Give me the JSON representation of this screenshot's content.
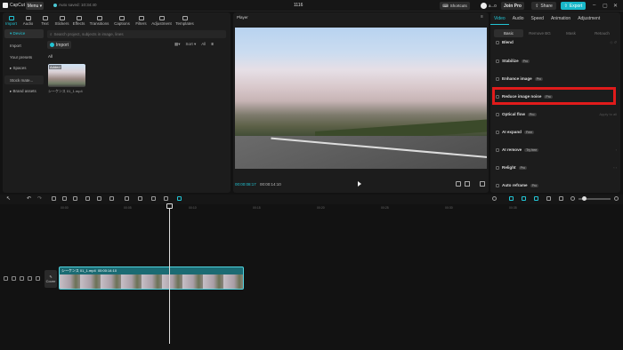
{
  "titlebar": {
    "app_name": "CapCut",
    "menu_label": "Menu",
    "autosave_text": "Auto saved: 10:34:40",
    "project_title": "1116",
    "shortcuts_label": "Shortcuts",
    "user_name": "a...0",
    "join_pro_label": "Join Pro",
    "share_label": "Share",
    "export_label": "Export"
  },
  "media_tabs": [
    {
      "label": "Import",
      "icon": "import-icon"
    },
    {
      "label": "Audio",
      "icon": "audio-icon"
    },
    {
      "label": "Text",
      "icon": "text-icon"
    },
    {
      "label": "Stickers",
      "icon": "stickers-icon"
    },
    {
      "label": "Effects",
      "icon": "effects-icon"
    },
    {
      "label": "Transitions",
      "icon": "transitions-icon"
    },
    {
      "label": "Captions",
      "icon": "captions-icon"
    },
    {
      "label": "Filters",
      "icon": "filters-icon"
    },
    {
      "label": "Adjustment",
      "icon": "adjustment-icon"
    },
    {
      "label": "Templates",
      "icon": "templates-icon"
    }
  ],
  "side_nav": [
    "▾ Device",
    "Import",
    "Your presets",
    "▸ Spaces",
    "Stock mate...",
    "▸ Brand assets"
  ],
  "media": {
    "search_placeholder": "Search project, subjects in image, lines",
    "import_label": "Import",
    "sort_label": "Sort",
    "all_filter": "All",
    "all_label": "All",
    "thumb_added": "Added",
    "thumb_name": "シーケンス 01_1.mp4"
  },
  "player": {
    "title": "Player",
    "time_current": "00:00:08:17",
    "time_total": "00:00:14:10"
  },
  "right_tabs": [
    "Video",
    "Audio",
    "Speed",
    "Animation",
    "Adjustment"
  ],
  "sub_tabs": [
    "Basic",
    "Remove BG",
    "Mask",
    "Retouch"
  ],
  "properties": [
    {
      "label": "Blend",
      "badge": ""
    },
    {
      "label": "Stabilize",
      "badge": "Pro"
    },
    {
      "label": "Enhance image",
      "badge": "Pro"
    },
    {
      "label": "Reduce image noise",
      "badge": "Pro"
    },
    {
      "label": "Optical flow",
      "badge": "Pro",
      "extra": "Apply to all"
    },
    {
      "label": "AI expand",
      "badge": "Free"
    },
    {
      "label": "AI remove",
      "badge": "Try free"
    },
    {
      "label": "Relight",
      "badge": "Pro"
    },
    {
      "label": "Auto reframe",
      "badge": "Pro"
    }
  ],
  "timeline": {
    "ticks": [
      "00:00",
      "00:05",
      "00:10",
      "00:15",
      "00:20",
      "00:25",
      "00:30",
      "00:35"
    ],
    "cover_label": "Cover",
    "clip_name": "シーケンス 01_1.mp4",
    "clip_duration": "00:00:14:10"
  },
  "colors": {
    "accent": "#22c4d4",
    "highlight": "#e01b1b",
    "export_button": "#18b7c9"
  }
}
